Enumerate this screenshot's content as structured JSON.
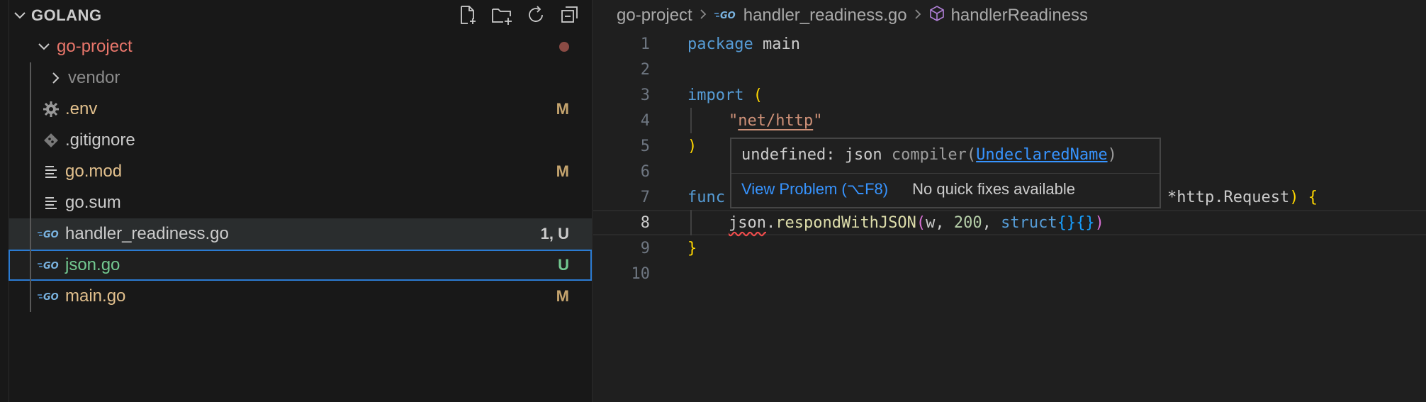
{
  "sidebar": {
    "section_title": "GOLANG",
    "actions": [
      {
        "name": "new-file-icon"
      },
      {
        "name": "new-folder-icon"
      },
      {
        "name": "refresh-icon"
      },
      {
        "name": "collapse-all-icon"
      }
    ],
    "root": {
      "label": "go-project",
      "color": "#e9766b"
    },
    "items": [
      {
        "label": "vendor",
        "icon": "chevron-right-icon",
        "badge": "",
        "color": "#8b8b8b"
      },
      {
        "label": ".env",
        "icon": "gear-icon",
        "badge": "M",
        "color": "#e2c08d"
      },
      {
        "label": ".gitignore",
        "icon": "git-icon",
        "badge": "",
        "color": "#cccccc"
      },
      {
        "label": "go.mod",
        "icon": "lines-icon",
        "badge": "M",
        "color": "#e2c08d"
      },
      {
        "label": "go.sum",
        "icon": "lines-icon",
        "badge": "",
        "color": "#cccccc"
      },
      {
        "label": "handler_readiness.go",
        "icon": "go-file-icon",
        "badge": "1, U",
        "color": "#cccccc"
      },
      {
        "label": "json.go",
        "icon": "go-file-icon",
        "badge": "U",
        "color": "#73c991"
      },
      {
        "label": "main.go",
        "icon": "go-file-icon",
        "badge": "M",
        "color": "#e2c08d"
      }
    ]
  },
  "editor": {
    "breadcrumb": {
      "folder": "go-project",
      "file": "handler_readiness.go",
      "symbol": "handlerReadiness"
    },
    "line_numbers": [
      "1",
      "2",
      "3",
      "4",
      "5",
      "6",
      "7",
      "8",
      "9",
      "10"
    ],
    "code": {
      "l1_kw": "package",
      "l1_rest": " main",
      "l3_kw": "import",
      "l3_paren": "(",
      "l4_q1": "\"",
      "l4_str": "net/http",
      "l4_q2": "\"",
      "l5": ")",
      "l7_kw": "func",
      "l7_tail": "*http.Request",
      "l7_paren": ")",
      "l7_brace": "{",
      "l8_obj": "json",
      "l8_dot": ".",
      "l8_fn": "respondWithJSON",
      "l8_open": "(",
      "l8_w": "w, ",
      "l8_num": "200",
      "l8_comma": ", ",
      "l8_struct": "struct",
      "l8_braces": "{}{}",
      "l8_close": ")",
      "l9": "}"
    },
    "hover": {
      "message_prefix": "undefined: json ",
      "source": "compiler",
      "open": "(",
      "code_link": "UndeclaredName",
      "close": ")",
      "view_problem": "View Problem (⌥F8)",
      "no_fixes": "No quick fixes available"
    }
  }
}
